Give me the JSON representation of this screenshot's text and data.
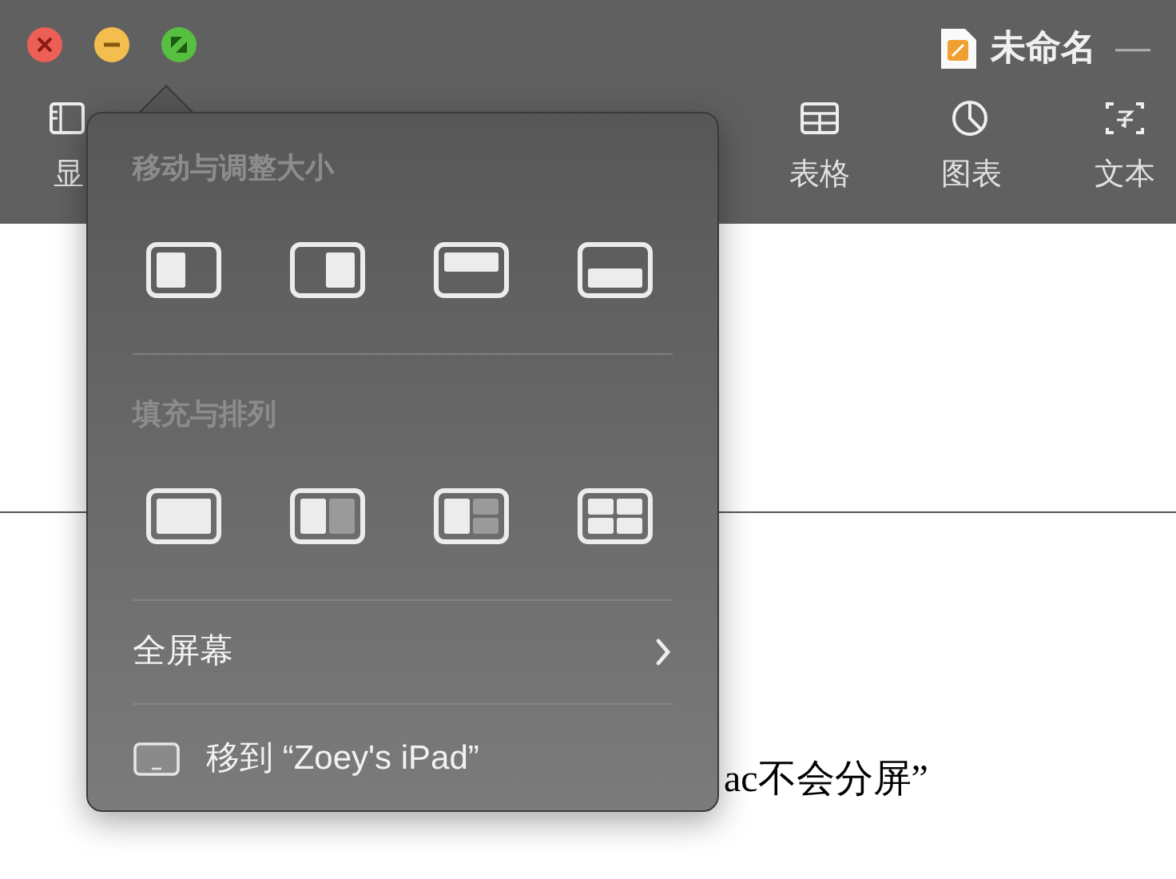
{
  "window": {
    "title": "未命名",
    "title_suffix": "—"
  },
  "toolbar": [
    {
      "label": "显",
      "kind": "view"
    },
    {
      "label": "表格",
      "kind": "table"
    },
    {
      "label": "图表",
      "kind": "chart"
    },
    {
      "label": "文本",
      "kind": "text"
    }
  ],
  "document": {
    "text": "ac不会分屏”"
  },
  "popover": {
    "sections": [
      {
        "heading": "移动与调整大小",
        "tiles": [
          {
            "kind": "left"
          },
          {
            "kind": "right"
          },
          {
            "kind": "top"
          },
          {
            "kind": "bottom"
          }
        ]
      },
      {
        "heading": "填充与排列",
        "tiles": [
          {
            "kind": "full"
          },
          {
            "kind": "halves"
          },
          {
            "kind": "thirds"
          },
          {
            "kind": "quarters"
          }
        ]
      }
    ],
    "items": [
      {
        "label": "全屏幕",
        "kind": "submenu"
      },
      {
        "label": "移到 “Zoey's iPad”",
        "kind": "device"
      }
    ]
  }
}
